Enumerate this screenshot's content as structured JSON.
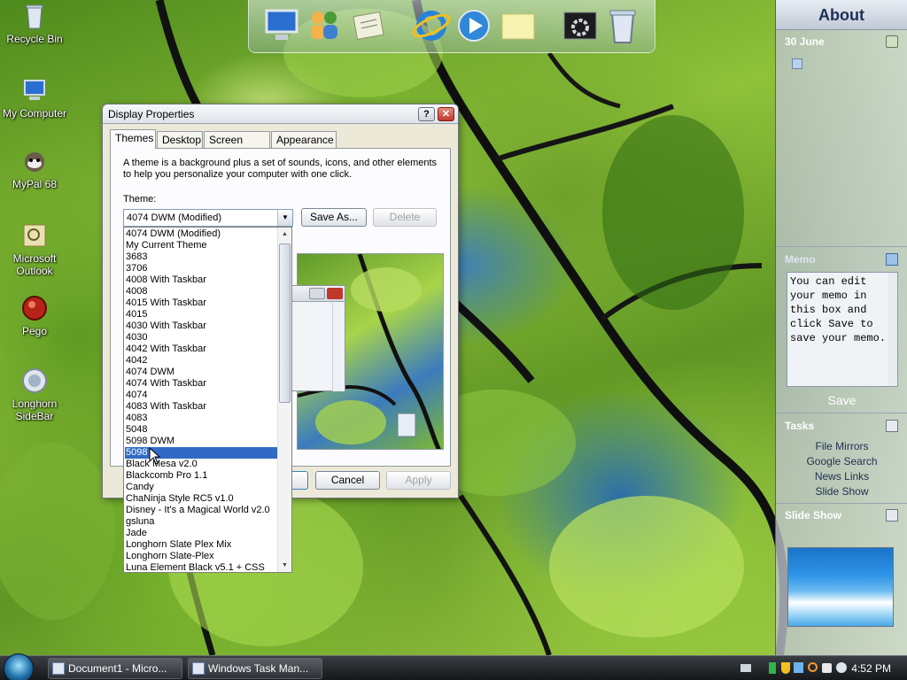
{
  "desktop": {
    "icons": [
      {
        "label": "Recycle Bin",
        "icon": "recycle-bin-icon"
      },
      {
        "label": "My Computer",
        "icon": "computer-icon"
      },
      {
        "label": "MyPal 68",
        "icon": "mypal-browser-icon"
      },
      {
        "label": "Microsoft Outlook",
        "icon": "outlook-icon"
      },
      {
        "label": "Pego",
        "icon": "pego-icon"
      },
      {
        "label": "Longhorn SideBar",
        "icon": "sidebar-icon"
      }
    ]
  },
  "dock": {
    "items": [
      "computer-icon",
      "users-icon",
      "notepad-icon",
      "internet-explorer-icon",
      "media-player-icon",
      "sticky-note-icon",
      "settings-icon",
      "recycle-bin-icon"
    ]
  },
  "window": {
    "title": "Display Properties",
    "help_button": "?",
    "close_button": "✕",
    "tabs": [
      {
        "label": "Themes"
      },
      {
        "label": "Desktop"
      },
      {
        "label": "Screen Saver"
      },
      {
        "label": "Appearance"
      }
    ],
    "description": "A theme is a background plus a set of sounds, icons, and other elements to help you personalize your computer with one click.",
    "theme_label": "Theme:",
    "theme_value": "4074 DWM (Modified)",
    "save_as_label": "Save As...",
    "delete_label": "Delete",
    "cancel_label": "Cancel",
    "apply_label": "Apply",
    "theme_options": [
      "4074 DWM (Modified)",
      "My Current Theme",
      "3683",
      "3706",
      "4008 With Taskbar",
      "4008",
      "4015 With Taskbar",
      "4015",
      "4030 With Taskbar",
      "4030",
      "4042 With Taskbar",
      "4042",
      "4074 DWM",
      "4074 With Taskbar",
      "4074",
      "4083 With Taskbar",
      "4083",
      "5048",
      "5098 DWM",
      "5098",
      "Black Mesa v2.0",
      "Blackcomb Pro 1.1",
      "Candy",
      "ChaNinja Style RC5 v1.0",
      "Disney - It's a Magical World v2.0",
      "gsluna",
      "Jade",
      "Longhorn Slate Plex Mix",
      "Longhorn Slate-Plex",
      "Luna Element Black v5.1 + CSS"
    ],
    "selected_option": "5098"
  },
  "sidebar": {
    "title": "About",
    "date": "30 June",
    "memo": {
      "header": "Memo",
      "text": "You can edit your memo in this box and click Save to save your memo.",
      "save_label": "Save"
    },
    "tasks": {
      "header": "Tasks",
      "items": [
        "File Mirrors",
        "Google Search",
        "News Links",
        "Slide Show"
      ]
    },
    "slideshow": {
      "header": "Slide Show"
    }
  },
  "taskbar": {
    "items": [
      {
        "label": "Document1 - Micro..."
      },
      {
        "label": "Windows Task Man..."
      }
    ],
    "clock": "4:52 PM"
  }
}
